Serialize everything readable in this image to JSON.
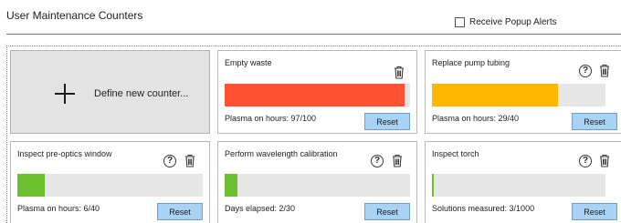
{
  "page": {
    "title": "User Maintenance Counters",
    "popup_alerts_label": "Receive Popup Alerts",
    "popup_alerts_checked": false
  },
  "define_card": {
    "label": "Define new counter..."
  },
  "counters": [
    {
      "title": "Empty waste",
      "status": "Plasma on hours: 97/100",
      "reset_label": "Reset",
      "progress": 0.97,
      "color": "#ff5233",
      "has_help": false
    },
    {
      "title": "Replace pump tubing",
      "status": "Plasma on hours: 29/40",
      "reset_label": "Reset",
      "progress": 0.725,
      "color": "#ffb800",
      "has_help": true
    },
    {
      "title": "Inspect pre-optics window",
      "status": "Plasma on hours: 6/40",
      "reset_label": "Reset",
      "progress": 0.15,
      "color": "#6cbf2f",
      "has_help": true
    },
    {
      "title": "Perform wavelength calibration",
      "status": "Days elapsed: 2/30",
      "reset_label": "Reset",
      "progress": 0.067,
      "color": "#6cbf2f",
      "has_help": true
    },
    {
      "title": "Inspect torch",
      "status": "Solutions measured: 3/1000",
      "reset_label": "Reset",
      "progress": 0.003,
      "color": "#6cbf2f",
      "has_help": true
    }
  ],
  "icons": {
    "help": "help-circle-icon",
    "delete": "trash-icon",
    "add": "plus-icon"
  }
}
